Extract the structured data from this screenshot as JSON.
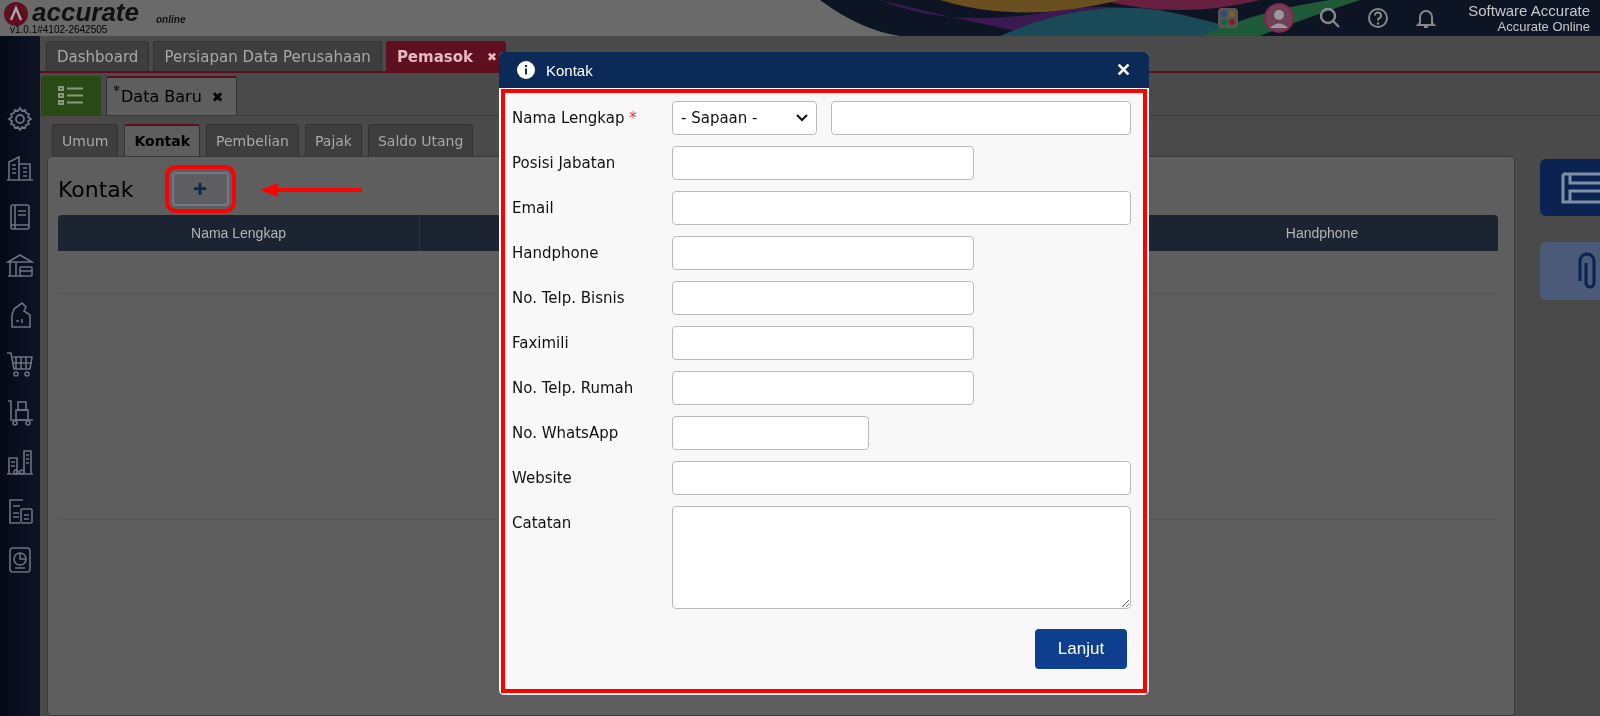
{
  "header": {
    "logo_text": "accurate",
    "logo_sub": "online",
    "version": "v1.0.1#4102-2642505",
    "user_title": "Software Accurate",
    "user_sub": "Accurate Online"
  },
  "sidebar": {
    "items": [
      {
        "kind": "gear"
      },
      {
        "kind": "building"
      },
      {
        "kind": "book"
      },
      {
        "kind": "bank"
      },
      {
        "kind": "bag"
      },
      {
        "kind": "cart"
      },
      {
        "kind": "trolley"
      },
      {
        "kind": "factory"
      },
      {
        "kind": "tax"
      },
      {
        "kind": "report"
      }
    ]
  },
  "tabs": [
    {
      "label": "Dashboard",
      "selected": false
    },
    {
      "label": "Persiapan Data Perusahaan",
      "selected": false
    },
    {
      "label": "Pemasok",
      "selected": true,
      "close": "✖"
    }
  ],
  "doc_tab": {
    "label": "Data Baru",
    "mark": "*",
    "close": "✖"
  },
  "sub_tabs": [
    {
      "label": "Umum",
      "selected": false
    },
    {
      "label": "Kontak",
      "selected": true
    },
    {
      "label": "Pembelian",
      "selected": false
    },
    {
      "label": "Pajak",
      "selected": false
    },
    {
      "label": "Saldo Utang",
      "selected": false
    }
  ],
  "section": {
    "title": "Kontak",
    "add_button": "+"
  },
  "table": {
    "columns": [
      {
        "label": "Nama Lengkap"
      },
      {
        "label": "Handphone"
      }
    ]
  },
  "dialog": {
    "title": "Kontak",
    "close": "✕",
    "fields": [
      {
        "label": "Nama Lengkap",
        "required": true,
        "kind": "name",
        "select_value": "- Sapaan -"
      },
      {
        "label": "Posisi Jabatan",
        "required": false,
        "kind": "text"
      },
      {
        "label": "Email",
        "required": false,
        "kind": "text"
      },
      {
        "label": "Handphone",
        "required": false,
        "kind": "text"
      },
      {
        "label": "No. Telp. Bisnis",
        "required": false,
        "kind": "text"
      },
      {
        "label": "Faximili",
        "required": false,
        "kind": "text"
      },
      {
        "label": "No. Telp. Rumah",
        "required": false,
        "kind": "text"
      },
      {
        "label": "No. WhatsApp",
        "required": false,
        "kind": "text"
      },
      {
        "label": "Website",
        "required": false,
        "kind": "text"
      },
      {
        "label": "Catatan",
        "required": false,
        "kind": "textarea"
      }
    ],
    "submit": "Lanjut"
  }
}
